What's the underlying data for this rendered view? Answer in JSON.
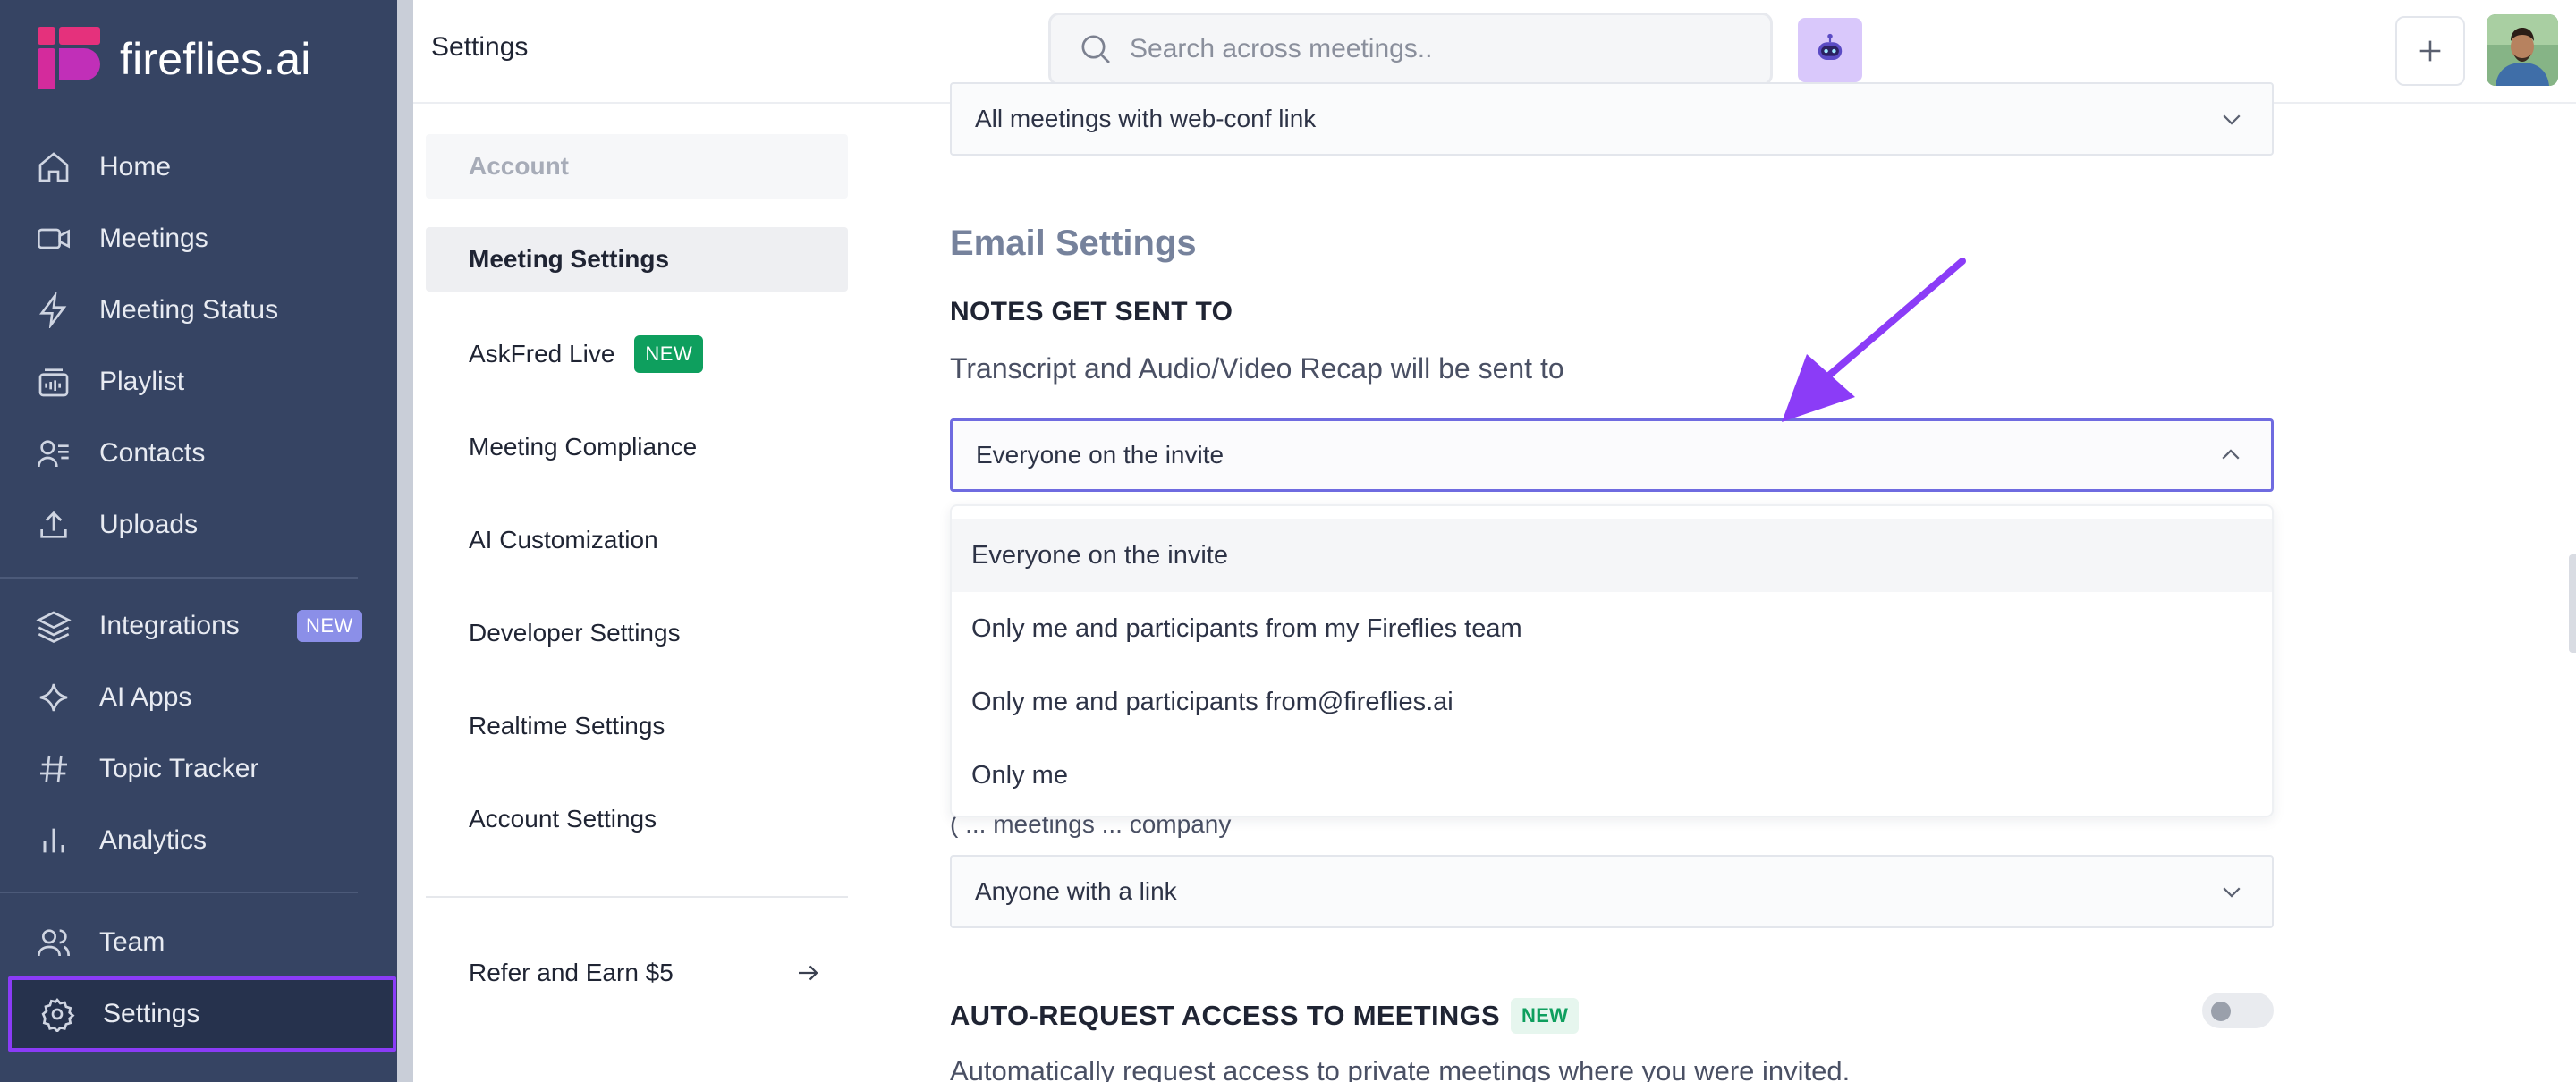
{
  "app": {
    "brand": "fireflies.ai",
    "brand_color": "#e5317c",
    "accent": "#8b3cf7"
  },
  "nav": {
    "items": [
      {
        "label": "Home",
        "icon": "home-icon"
      },
      {
        "label": "Meetings",
        "icon": "video-icon"
      },
      {
        "label": "Meeting Status",
        "icon": "lightning-icon"
      },
      {
        "label": "Playlist",
        "icon": "playlist-icon"
      },
      {
        "label": "Contacts",
        "icon": "contacts-icon"
      },
      {
        "label": "Uploads",
        "icon": "upload-icon"
      },
      {
        "label": "Integrations",
        "icon": "layers-icon",
        "badge": "NEW"
      },
      {
        "label": "AI Apps",
        "icon": "sparkle-icon"
      },
      {
        "label": "Topic Tracker",
        "icon": "hash-icon"
      },
      {
        "label": "Analytics",
        "icon": "bar-chart-icon"
      },
      {
        "label": "Team",
        "icon": "team-icon"
      },
      {
        "label": "Settings",
        "icon": "gear-icon",
        "active": true
      }
    ]
  },
  "header": {
    "title": "Settings",
    "search_placeholder": "Search across meetings.."
  },
  "submenu": {
    "header": "Account",
    "items": [
      {
        "label": "Meeting Settings",
        "selected": true
      },
      {
        "label": "AskFred Live",
        "badge": "NEW"
      },
      {
        "label": "Meeting Compliance"
      },
      {
        "label": "AI Customization"
      },
      {
        "label": "Developer Settings"
      },
      {
        "label": "Realtime Settings"
      },
      {
        "label": "Account Settings"
      }
    ],
    "refer": "Refer and Earn $5"
  },
  "main": {
    "top_select_value": "All meetings with web-conf link",
    "email_settings_heading": "Email Settings",
    "notes_heading": "NOTES GET SENT TO",
    "notes_desc": "Transcript and Audio/Video Recap will be sent to",
    "notes_select_value": "Everyone on the invite",
    "notes_options": [
      "Everyone on the invite",
      "Only me and participants from my Fireflies team",
      "Only me and participants from@fireflies.ai",
      "Only me"
    ],
    "obscured_text": "(... meetings... company",
    "link_select_value": "Anyone with a link",
    "auto_heading": "AUTO-REQUEST ACCESS TO MEETINGS",
    "auto_badge": "NEW",
    "auto_desc": "Automatically request access to private meetings where you were invited.",
    "auto_enabled": false
  }
}
